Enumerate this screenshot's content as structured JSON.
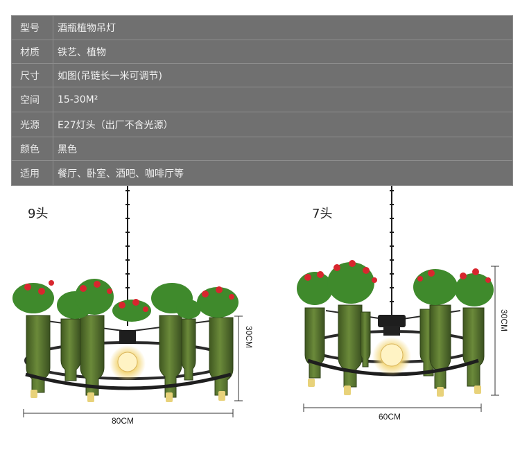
{
  "spec_table": {
    "rows": [
      {
        "label": "型号",
        "value": "酒瓶植物吊灯"
      },
      {
        "label": "材质",
        "value": "铁艺、植物"
      },
      {
        "label": "尺寸",
        "value": "如图(吊链长一米可调节)"
      },
      {
        "label": "空间",
        "value": "15-30M²"
      },
      {
        "label": "光源",
        "value": "E27灯头（出厂不含光源）"
      },
      {
        "label": "颜色",
        "value": "黑色"
      },
      {
        "label": "适用",
        "value": "餐厅、卧室、酒吧、咖啡厅等"
      }
    ]
  },
  "products": [
    {
      "variant_label": "9头",
      "height_dim": "30CM",
      "width_dim": "80CM"
    },
    {
      "variant_label": "7头",
      "height_dim": "30CM",
      "width_dim": "60CM"
    }
  ],
  "colors": {
    "table_bg": "#707070",
    "bottle_green": "#4f6a2a",
    "flower_red": "#d8262e",
    "leaf_green": "#3f8a2c",
    "iron": "#1e1e1e"
  }
}
